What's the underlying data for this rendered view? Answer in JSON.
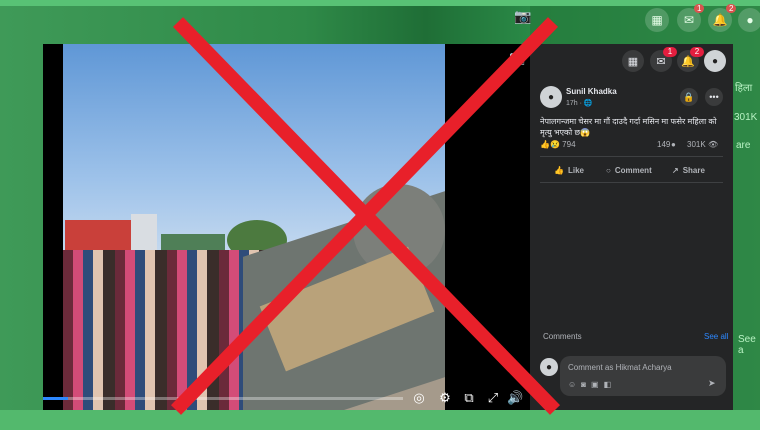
{
  "background": {
    "badges": [
      "1",
      "2"
    ],
    "partial_text": [
      "हिला",
      "301K",
      "are",
      "See a"
    ]
  },
  "post": {
    "author": "Sunil Khadka",
    "meta": "17h · 🌐",
    "text": "नेपालगन्जमा चेसर मा गौं दाउदै गर्दा मसिन मा फसेर महिला को मृत्यु भएको छ😱",
    "reaction_count": "794",
    "comments_count": "149",
    "views_count": "301K"
  },
  "topbar": {
    "messenger_badge": "1",
    "notifications_badge": "2"
  },
  "actions": {
    "like": "Like",
    "comment": "Comment",
    "share": "Share"
  },
  "comments": {
    "label": "Comments",
    "see_all": "See all",
    "placeholder": "Comment as Hikmat Acharya"
  },
  "video": {
    "progress_fraction": 0.07
  },
  "colors": {
    "overlay_x": "#e8202a",
    "panel_bg": "#242526",
    "link_blue": "#2d88ff"
  },
  "icons": [
    "grid-menu-icon",
    "messenger-icon",
    "bell-icon",
    "more-icon",
    "lock-icon",
    "globe-icon",
    "like-icon",
    "comment-icon",
    "share-icon",
    "eye-icon",
    "settings-icon",
    "pip-icon",
    "fullscreen-icon",
    "volume-icon",
    "camera-icon",
    "emoji-icon",
    "sticker-icon",
    "gif-icon",
    "send-icon"
  ]
}
